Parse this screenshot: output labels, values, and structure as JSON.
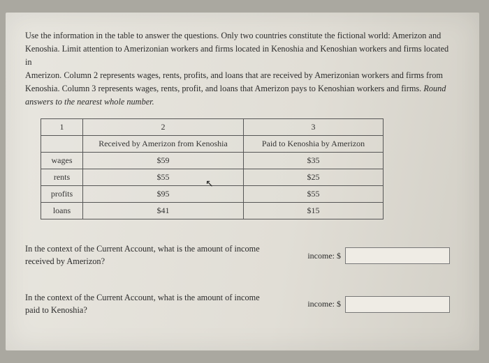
{
  "intro": {
    "line1": "Use the information in the table to answer the questions. Only two countries constitute the fictional world: Amerizon and",
    "line2": "Kenoshia. Limit attention to Amerizonian workers and firms located in Kenoshia and Kenoshian workers and firms located in",
    "line3": "Amerizon. Column 2 represents wages, rents, profits, and loans that are received by Amerizonian workers and firms from",
    "line4": "Kenoshia. Column 3 represents wages, rents, profit, and loans that Amerizon pays to Kenoshian workers and firms. ",
    "italic": "Round answers to the nearest whole number."
  },
  "table": {
    "headers": {
      "c1": "1",
      "c2": "2",
      "c3": "3"
    },
    "subheaders": {
      "c2": "Received by Amerizon from Kenoshia",
      "c3": "Paid to Kenoshia by Amerizon"
    },
    "rows": [
      {
        "label": "wages",
        "c2": "$59",
        "c3": "$35"
      },
      {
        "label": "rents",
        "c2": "$55",
        "c3": "$25"
      },
      {
        "label": "profits",
        "c2": "$95",
        "c3": "$55"
      },
      {
        "label": "loans",
        "c2": "$41",
        "c3": "$15"
      }
    ]
  },
  "q1": {
    "text": "In the context of the Current Account, what is the amount of income received by Amerizon?",
    "label": "income: $",
    "value": ""
  },
  "q2": {
    "text": "In the context of the Current Account, what is the amount of income paid to Kenoshia?",
    "label": "income: $",
    "value": ""
  },
  "cursor_glyph": "↖"
}
